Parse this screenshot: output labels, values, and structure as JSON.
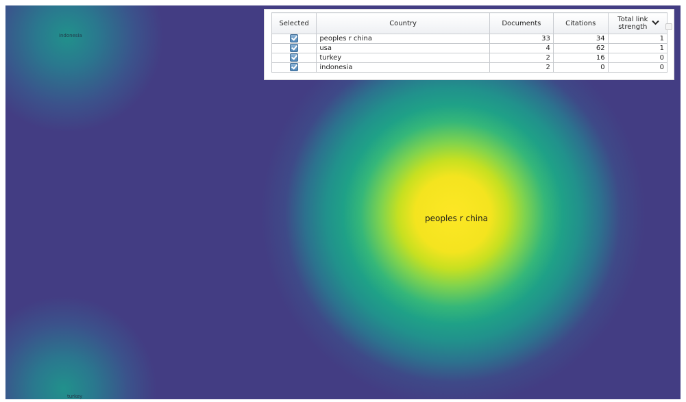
{
  "map": {
    "labels": {
      "china": "peoples r china",
      "indonesia": "indonesia",
      "turkey": "turkey"
    },
    "colors": {
      "background": "#433d83",
      "hotspot_center": "#fde725",
      "hotspot_mid": "#35b779",
      "hotspot_edge": "#21918c"
    }
  },
  "table": {
    "headers": {
      "selected": "Selected",
      "country": "Country",
      "documents": "Documents",
      "citations": "Citations",
      "total_link_strength": "Total link strength"
    },
    "sort_icon": "chevron-down-icon",
    "rows": [
      {
        "selected": true,
        "country": "peoples r china",
        "documents": "33",
        "citations": "34",
        "total_link_strength": "1"
      },
      {
        "selected": true,
        "country": "usa",
        "documents": "4",
        "citations": "62",
        "total_link_strength": "1"
      },
      {
        "selected": true,
        "country": "turkey",
        "documents": "2",
        "citations": "16",
        "total_link_strength": "0"
      },
      {
        "selected": true,
        "country": "indonesia",
        "documents": "2",
        "citations": "0",
        "total_link_strength": "0"
      }
    ]
  }
}
